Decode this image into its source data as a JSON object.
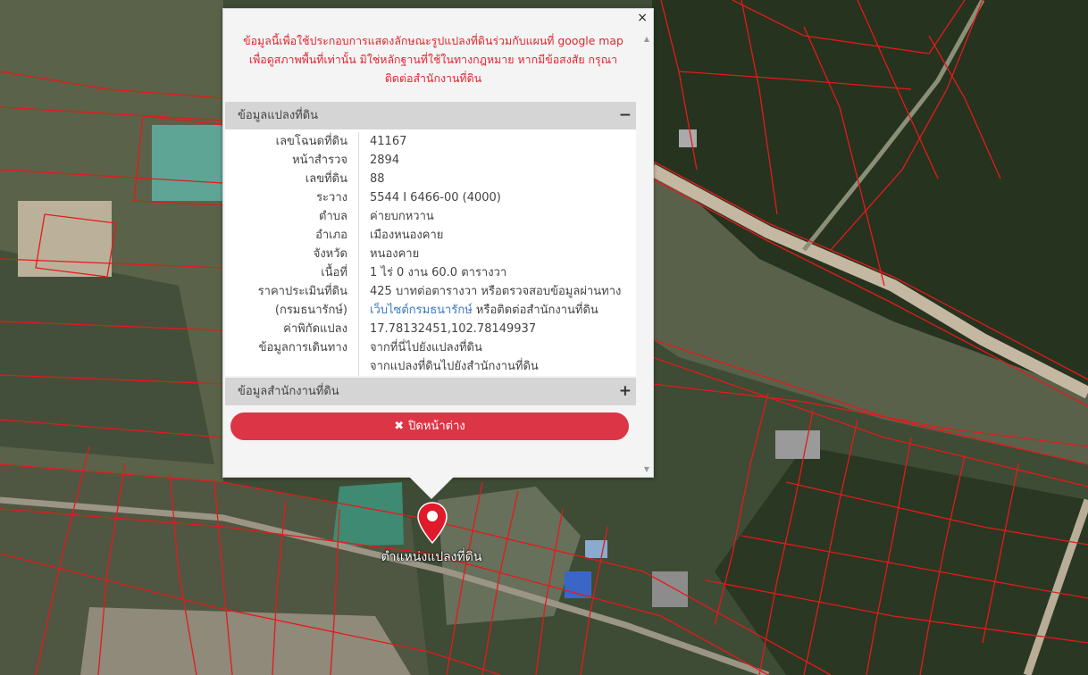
{
  "map": {
    "colors": {
      "parcel_line": "#e51a1a",
      "vegetation": "#2f3d2a",
      "field": "#6e7660",
      "road": "#c2b49e"
    },
    "marker_icon": "map-pin-icon",
    "marker_label": "ตำแหน่งแปลงที่ดิน"
  },
  "popup": {
    "close_icon": "×",
    "notice_lines": [
      "ข้อมูลนี้เพื่อใช้ประกอบการแสดงลักษณะรูปแปลงที่ดินร่วมกับแผนที่ google map",
      "เพื่อดูสภาพพื้นที่เท่านั้น มิใช่หลักฐานที่ใช้ในทางกฎหมาย หากมีข้อสงสัย กรุณา",
      "ติดต่อสำนักงานที่ดิน"
    ],
    "parcel_panel": {
      "title": "ข้อมูลแปลงที่ดิน",
      "toggle": "−",
      "rows": [
        {
          "label": "เลขโฉนดที่ดิน",
          "value": "41167"
        },
        {
          "label": "หน้าสำรวจ",
          "value": "2894"
        },
        {
          "label": "เลขที่ดิน",
          "value": "88"
        },
        {
          "label": "ระวาง",
          "value": "5544 I 6466-00 (4000)"
        },
        {
          "label": "ตำบล",
          "value": "ค่ายบกหวาน"
        },
        {
          "label": "อำเภอ",
          "value": "เมืองหนองคาย"
        },
        {
          "label": "จังหวัด",
          "value": "หนองคาย"
        },
        {
          "label": "เนื้อที่",
          "value": "1 ไร่ 0 งาน 60.0 ตารางวา"
        }
      ],
      "appraisal": {
        "label1": "ราคาประเมินที่ดิน",
        "value1": "425 บาทต่อตารางวา หรือตรวจสอบข้อมูลผ่านทาง",
        "label2": "(กรมธนารักษ์)",
        "link": "เว็บไซต์กรมธนารักษ์",
        "tail": " หรือติดต่อสำนักงานที่ดิน"
      },
      "coords": {
        "label": "ค่าพิกัดแปลง",
        "value": "17.78132451,102.78149937"
      },
      "travel": {
        "label": "ข้อมูลการเดินทาง",
        "link1": "จากที่นี่ไปยังแปลงที่ดิน",
        "link2": "จากแปลงที่ดินไปยังสำนักงานที่ดิน"
      }
    },
    "office_panel": {
      "title": "ข้อมูลสำนักงานที่ดิน",
      "toggle": "+"
    },
    "close_button": {
      "icon": "✖",
      "label": "ปิดหน้าต่าง"
    },
    "colors": {
      "notice": "#e0262f",
      "link": "#3c78c3",
      "button": "#dc3545"
    }
  }
}
